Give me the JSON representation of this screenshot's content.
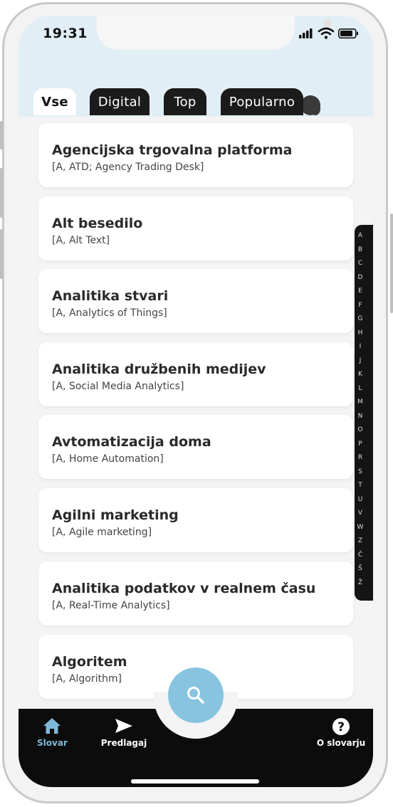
{
  "status_bar": {
    "time": "19:31"
  },
  "tabs": [
    {
      "label": "Vse",
      "active": true
    },
    {
      "label": "Digital",
      "active": false
    },
    {
      "label": "Top",
      "active": false
    },
    {
      "label": "Popularno",
      "active": false
    }
  ],
  "entries": [
    {
      "title": "Agencijska trgovalna platforma",
      "subtitle": "[A, ATD; Agency Trading Desk]"
    },
    {
      "title": "Alt besedilo",
      "subtitle": "[A, Alt Text]"
    },
    {
      "title": "Analitika stvari",
      "subtitle": "[A, Analytics of Things]"
    },
    {
      "title": "Analitika družbenih medijev",
      "subtitle": "[A, Social Media Analytics]"
    },
    {
      "title": "Avtomatizacija doma",
      "subtitle": "[A, Home Automation]"
    },
    {
      "title": "Agilni marketing",
      "subtitle": "[A, Agile marketing]"
    },
    {
      "title": "Analitika podatkov v realnem času",
      "subtitle": "[A, Real-Time Analytics]"
    },
    {
      "title": "Algoritem",
      "subtitle": "[A, Algorithm]"
    }
  ],
  "alphabet": [
    "A",
    "B",
    "C",
    "D",
    "E",
    "F",
    "G",
    "H",
    "I",
    "J",
    "K",
    "L",
    "M",
    "N",
    "O",
    "P",
    "R",
    "S",
    "T",
    "U",
    "V",
    "W",
    "Z",
    "Č",
    "Š",
    "Ž"
  ],
  "bottom_nav": {
    "home_label": "Slovar",
    "suggest_label": "Predlagaj",
    "about_label": "O slovarju"
  },
  "colors": {
    "accent": "#88c4e0",
    "header_bg": "#e1eef5",
    "nav_bg": "#0c0c0c",
    "tab_dark": "#1b1b1b"
  },
  "icons": {
    "fab": "search-icon",
    "home": "home-icon",
    "suggest": "send-icon",
    "about": "help-icon"
  }
}
